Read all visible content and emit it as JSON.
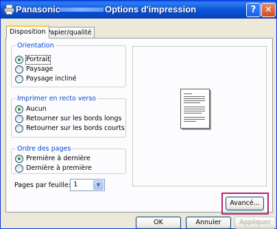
{
  "window": {
    "brand": "Panasonic",
    "title": "Options d'impression",
    "help_symbol": "?",
    "close_symbol": "✕"
  },
  "tabs": [
    {
      "label": "Disposition",
      "active": true
    },
    {
      "label": "Papier/qualité",
      "active": false
    }
  ],
  "orientation": {
    "legend": "Orientation",
    "options": [
      "Portrait",
      "Paysage",
      "Paysage incliné"
    ],
    "selected": "Portrait"
  },
  "duplex": {
    "legend": "Imprimer en recto verso",
    "options": [
      "Aucun",
      "Retourner sur les bords longs",
      "Retourner sur les bords courts"
    ],
    "selected": "Aucun"
  },
  "page_order": {
    "legend": "Ordre des pages",
    "options": [
      "Première à dernière",
      "Dernière à première"
    ],
    "selected": "Première à dernière"
  },
  "pages_per_sheet": {
    "label": "Pages par feuille:",
    "value": "1"
  },
  "buttons": {
    "advanced": "Avancé...",
    "ok": "OK",
    "cancel": "Annuler",
    "apply": "Appliquer"
  },
  "colors": {
    "titlebar": "#0b55d8",
    "legend_text": "#0046d5",
    "highlight_outline": "#b3206a"
  }
}
